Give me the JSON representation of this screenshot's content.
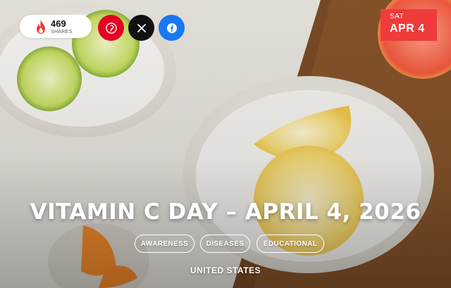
{
  "shares": {
    "count": "469",
    "label": "SHARES",
    "icon": "flame-icon"
  },
  "social": [
    {
      "name": "pinterest",
      "icon": "pinterest-icon",
      "color": "#e60023"
    },
    {
      "name": "x",
      "icon": "x-icon",
      "color": "#111111"
    },
    {
      "name": "facebook",
      "icon": "facebook-icon",
      "color": "#1877f2"
    }
  ],
  "date_badge": {
    "weekday": "SAT",
    "date": "APR 4",
    "color": "#ef3b3b"
  },
  "title": "VITAMIN C DAY – APRIL 4, 2026",
  "tags": [
    "AWARENESS",
    "DISEASES",
    "EDUCATIONAL"
  ],
  "location": "UNITED STATES"
}
